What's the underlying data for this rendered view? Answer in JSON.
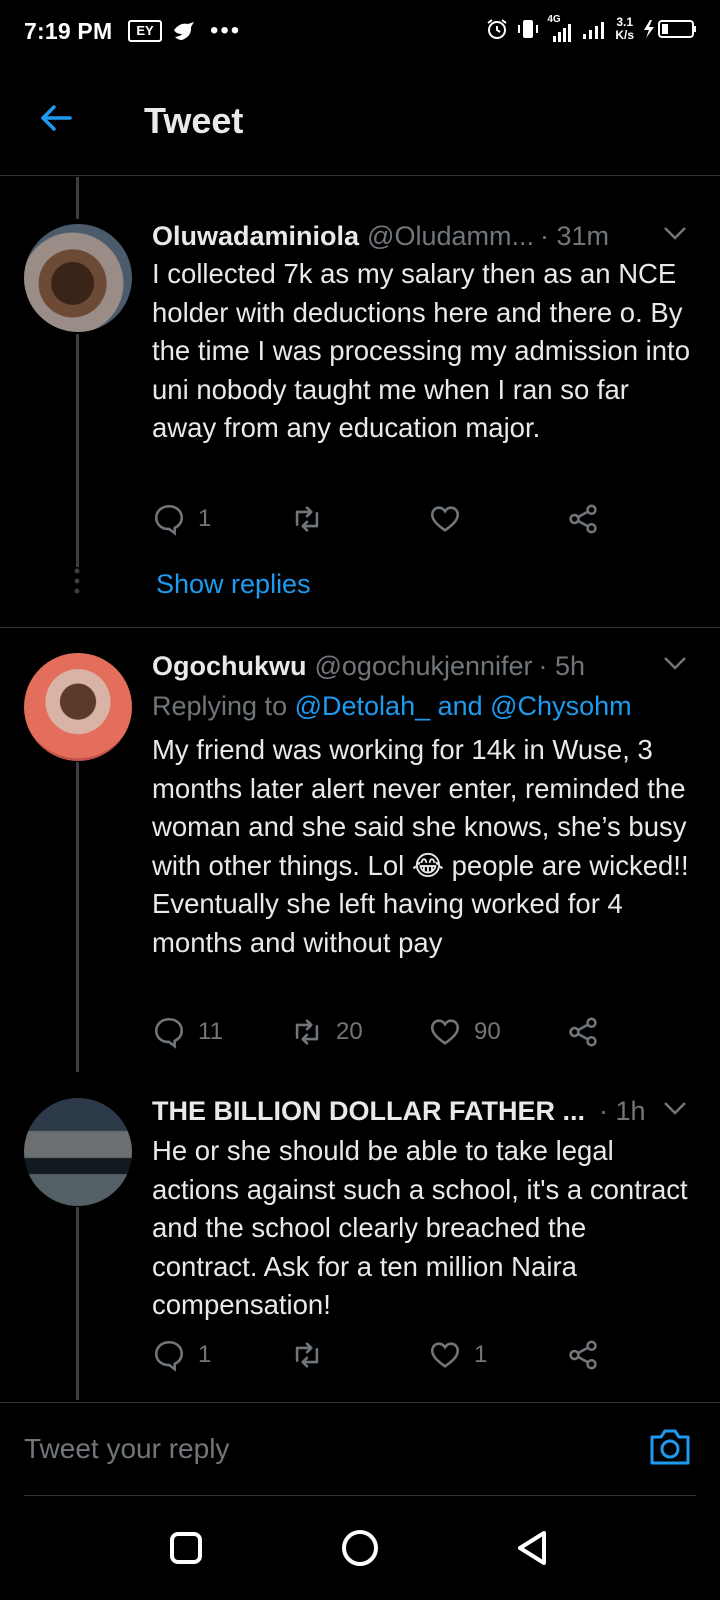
{
  "status_bar": {
    "time": "7:19 PM",
    "carrier_badge": "EY",
    "network_type": "4G",
    "speed_value": "3.1",
    "speed_unit": "K/s"
  },
  "header": {
    "title": "Tweet"
  },
  "tweets": [
    {
      "name": "Oluwadaminiola",
      "handle": "@Oludamm...",
      "time": "· 31m",
      "text": "I collected 7k as my salary then as an NCE holder with deductions here and there o. By the time I was processing my admission into uni nobody taught me when I ran so far away from any education major.",
      "replies": "1",
      "retweets": "",
      "likes": "",
      "show_replies_label": "Show replies"
    },
    {
      "name": "Ogochukwu",
      "handle": "@ogochukjennifer",
      "time": "· 5h",
      "replying_prefix": "Replying to",
      "replying_to": "@Detolah_ and @Chysohm",
      "text": "My friend was working for 14k in Wuse, 3 months later alert never enter, reminded the woman and she said she knows, she’s busy with other things. Lol 😂 people are wicked!! Eventually she left having worked for 4 months and without pay",
      "replies": "11",
      "retweets": "20",
      "likes": "90"
    },
    {
      "name": "THE BILLION DOLLAR FATHER ...",
      "handle": "",
      "time": "· 1h",
      "text": "He or she should be able to take legal actions against such a school, it's a contract and the school clearly breached the contract. Ask for a ten million Naira compensation!",
      "replies": "1",
      "retweets": "",
      "likes": "1"
    }
  ],
  "composer": {
    "placeholder": "Tweet your reply"
  },
  "colors": {
    "background": "#000000",
    "accent": "#1d9bf0",
    "muted": "#71767b",
    "text": "#e7e9ea"
  }
}
